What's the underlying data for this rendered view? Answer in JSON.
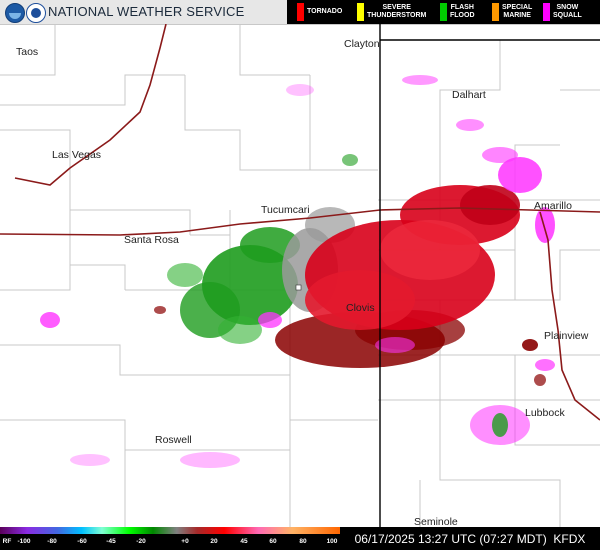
{
  "header": {
    "agency_name": "NATIONAL WEATHER SERVICE",
    "logos": [
      "noaa-logo",
      "nws-logo"
    ],
    "legend": [
      {
        "label_line1": "TORNADO",
        "label_line2": "",
        "color": "#ff0000"
      },
      {
        "label_line1": "SEVERE",
        "label_line2": "THUNDERSTORM",
        "color": "#ffff00"
      },
      {
        "label_line1": "FLASH",
        "label_line2": "FLOOD",
        "color": "#00cc00"
      },
      {
        "label_line1": "SPECIAL",
        "label_line2": "MARINE",
        "color": "#ff9900"
      },
      {
        "label_line1": "SNOW",
        "label_line2": "SQUALL",
        "color": "#ff00ff"
      }
    ]
  },
  "map": {
    "cities": [
      "Taos",
      "Clayton",
      "Dalhart",
      "Las Vegas",
      "Tucumcari",
      "Amarillo",
      "Santa Rosa",
      "Clovis",
      "Plainview",
      "Lubbock",
      "Roswell",
      "Seminole"
    ],
    "colors": {
      "state_border": "#000000",
      "county_lines": "#c8c8c8",
      "interstate": "#8b1a1a",
      "reflectivity_red": "#d8001a",
      "reflectivity_darkred": "#8a0000",
      "reflectivity_green": "#1e9c1e",
      "reflectivity_magenta": "#ff33ff",
      "reflectivity_gray": "#9a9a9a"
    }
  },
  "scale": {
    "prefix": "RF",
    "ticks": [
      "-100",
      "-80",
      "-60",
      "-45",
      "-20",
      "+0",
      "20",
      "45",
      "60",
      "80",
      "100"
    ]
  },
  "status": {
    "timestamp": "06/17/2025 13:27 UTC (07:27 MDT)",
    "radar_site": "KFDX"
  }
}
